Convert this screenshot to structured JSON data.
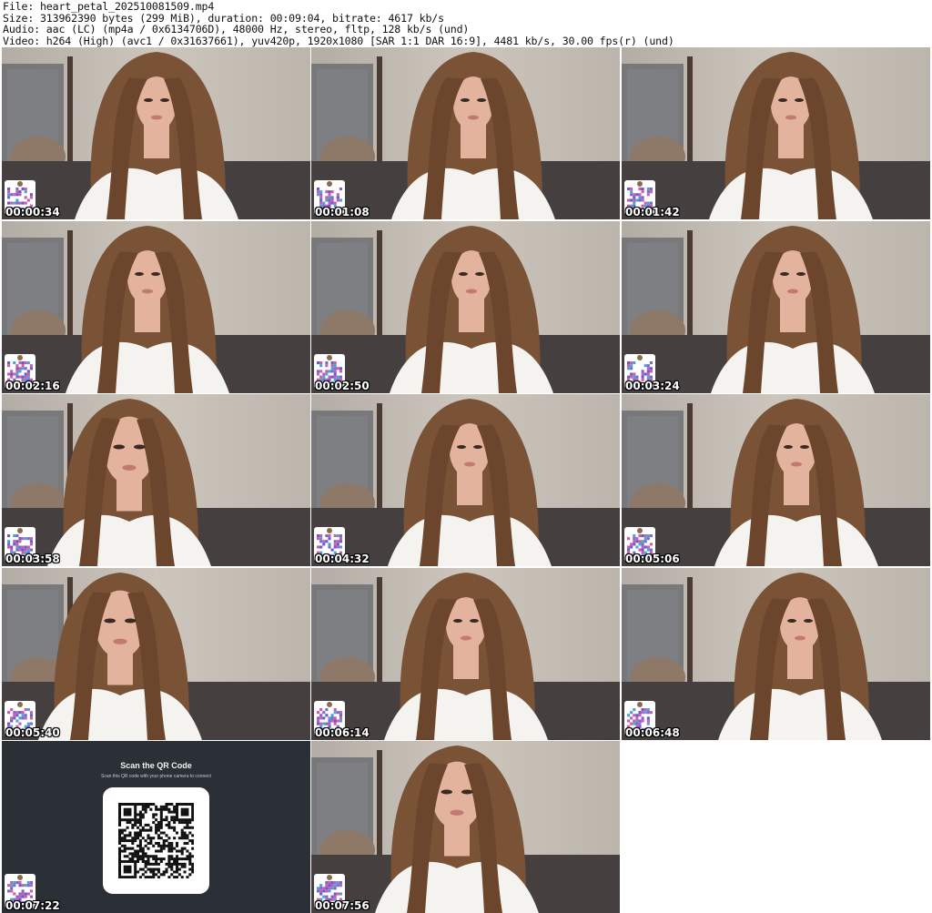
{
  "header": {
    "file_line": "File: heart_petal_202510081509.mp4",
    "size_line": "Size: 313962390 bytes (299 MiB), duration: 00:09:04, bitrate: 4617 kb/s",
    "audio_line": "Audio: aac (LC) (mp4a / 0x6134706D), 48000 Hz, stereo, fltp, 128 kb/s (und)",
    "video_line": "Video: h264 (High) (avc1 / 0x31637661), yuv420p, 1920x1080 [SAR 1:1 DAR 16:9], 4481 kb/s, 30.00 fps(r) (und)"
  },
  "thumbnails": [
    {
      "timestamp": "00:00:34",
      "kind": "camera"
    },
    {
      "timestamp": "00:01:08",
      "kind": "camera"
    },
    {
      "timestamp": "00:01:42",
      "kind": "camera"
    },
    {
      "timestamp": "00:02:16",
      "kind": "camera"
    },
    {
      "timestamp": "00:02:50",
      "kind": "camera"
    },
    {
      "timestamp": "00:03:24",
      "kind": "camera"
    },
    {
      "timestamp": "00:03:58",
      "kind": "camera"
    },
    {
      "timestamp": "00:04:32",
      "kind": "camera"
    },
    {
      "timestamp": "00:05:06",
      "kind": "camera"
    },
    {
      "timestamp": "00:05:40",
      "kind": "camera"
    },
    {
      "timestamp": "00:06:14",
      "kind": "camera"
    },
    {
      "timestamp": "00:06:48",
      "kind": "camera"
    },
    {
      "timestamp": "00:07:22",
      "kind": "qr-screen"
    },
    {
      "timestamp": "00:07:56",
      "kind": "camera"
    }
  ],
  "qr_screen": {
    "title": "Scan the QR Code",
    "subtitle": "Scan this QR code with your phone camera to connect"
  },
  "colors": {
    "wall": "#c6bfb6",
    "door": "#6d6f72",
    "hair": "#7a5236",
    "skin": "#e4b39d",
    "shirt": "#f4f3f0",
    "sofa": "#45403f",
    "qr_panel_bg": "#2b2f36"
  }
}
